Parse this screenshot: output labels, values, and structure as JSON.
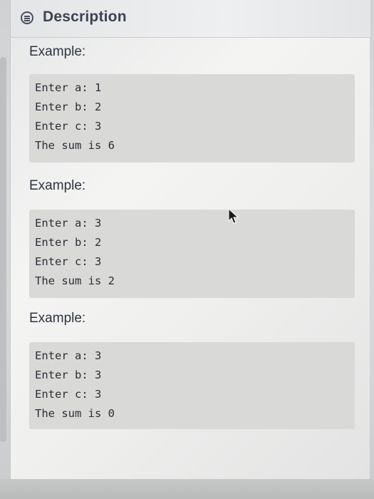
{
  "header": {
    "title": "Description",
    "icon": "description-icon"
  },
  "examples": [
    {
      "label": "Example:",
      "lines": [
        "Enter a: 1",
        "Enter b: 2",
        "Enter c: 3",
        "The sum is 6"
      ]
    },
    {
      "label": "Example:",
      "lines": [
        "Enter a: 3",
        "Enter b: 2",
        "Enter c: 3",
        "The sum is 2"
      ]
    },
    {
      "label": "Example:",
      "lines": [
        "Enter a: 3",
        "Enter b: 3",
        "Enter c: 3",
        "The sum is 0"
      ]
    }
  ],
  "colors": {
    "code_background": "#d9d9d7",
    "text": "#2f3440",
    "header_text": "#3d4350"
  }
}
